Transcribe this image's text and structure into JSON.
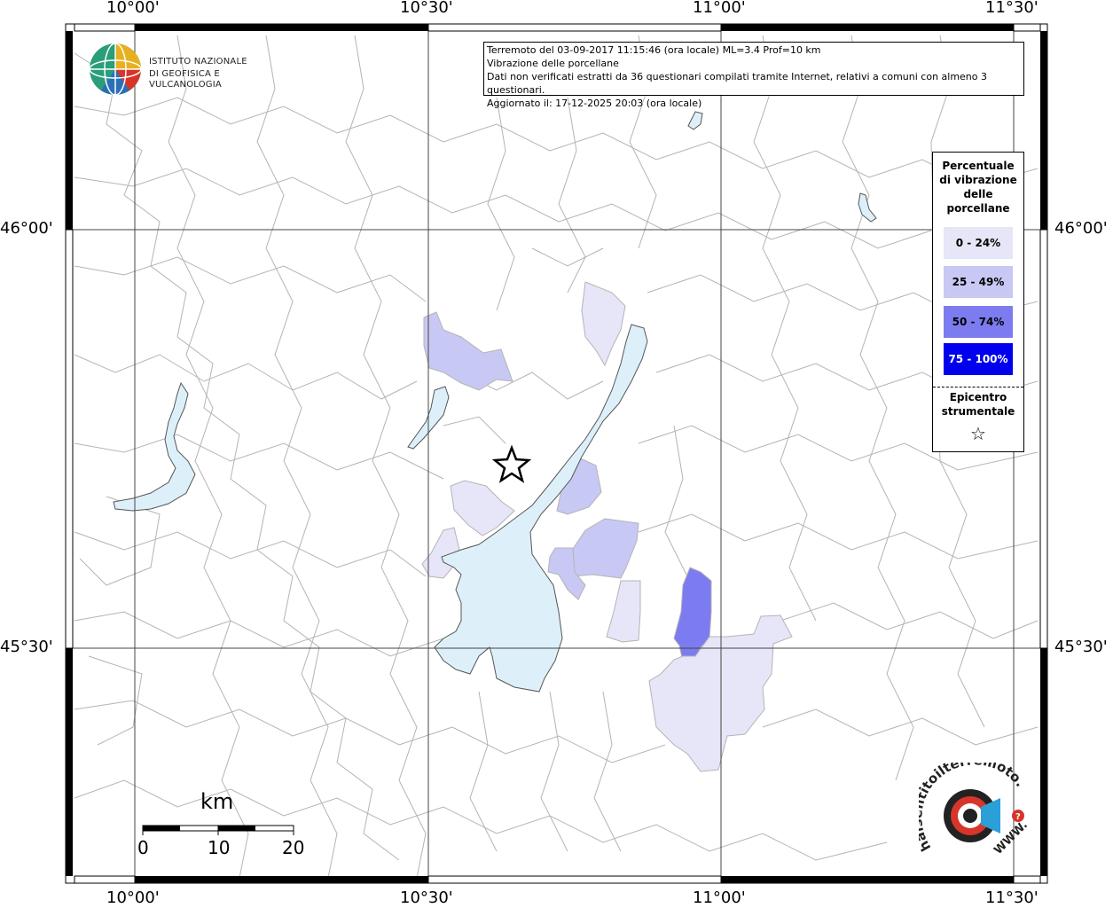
{
  "logo": {
    "line1": "ISTITUTO NAZIONALE",
    "line2": "DI GEOFISICA E VULCANOLOGIA"
  },
  "info": {
    "line1": "Terremoto del 03-09-2017 11:15:46 (ora locale) ML=3.4 Prof=10 km",
    "line2": "Vibrazione delle porcellane",
    "line3": "Dati non verificati estratti da 36 questionari compilati tramite Internet, relativi a comuni con almeno 3 questionari.",
    "line4": "Aggiornato il: 17-12-2025 20:03 (ora locale)"
  },
  "axes": {
    "top": [
      "10°00'",
      "10°30'",
      "11°00'",
      "11°30'"
    ],
    "bottom": [
      "10°00'",
      "10°30'",
      "11°00'",
      "11°30'"
    ],
    "left": [
      "46°00'",
      "45°30'"
    ],
    "right": [
      "46°00'",
      "45°30'"
    ]
  },
  "legend": {
    "title_lines": [
      "Percentuale",
      "di vibrazione",
      "delle",
      "porcellane"
    ],
    "classes": [
      {
        "label": "0 - 24%",
        "color": "#e6e6f8",
        "text_color": "#000000"
      },
      {
        "label": "25 - 49%",
        "color": "#c8c8f4",
        "text_color": "#000000"
      },
      {
        "label": "50 - 74%",
        "color": "#7c7cf0",
        "text_color": "#000000"
      },
      {
        "label": "75 - 100%",
        "color": "#0000ee",
        "text_color": "#ffffff"
      }
    ],
    "epicenter_lines": [
      "Epicentro",
      "strumentale"
    ],
    "epicenter_symbol": "☆"
  },
  "scale": {
    "unit": "km",
    "ticks": [
      "0",
      "10",
      "20"
    ]
  },
  "watermark": {
    "text": "haisentitoilterremoto.it",
    "url_text": "WWW.",
    "icon": "seismometer-icon"
  },
  "colors": {
    "lake": "#ddf0fa",
    "border": "#b0b0b0",
    "grid": "#555555",
    "epicenter": "#000000"
  }
}
